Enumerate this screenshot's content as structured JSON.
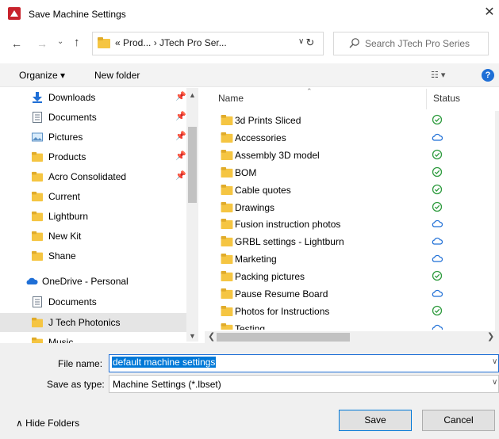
{
  "window": {
    "title": "Save Machine Settings",
    "close": "✕"
  },
  "address": {
    "path": "«  Prod...  ›  JTech Pro Ser...",
    "search_placeholder": "Search JTech Pro Series"
  },
  "toolbar": {
    "organize": "Organize ▾",
    "new_folder": "New folder",
    "view": "☷ ▾",
    "help": "?"
  },
  "nav": {
    "items": [
      {
        "label": "Downloads",
        "icon": "download-icon",
        "pinned": true
      },
      {
        "label": "Documents",
        "icon": "document-icon",
        "pinned": true
      },
      {
        "label": "Pictures",
        "icon": "pictures-icon",
        "pinned": true
      },
      {
        "label": "Products",
        "icon": "folder-icon",
        "pinned": true
      },
      {
        "label": "Acro Consolidated",
        "icon": "folder-icon",
        "pinned": true
      },
      {
        "label": "Current",
        "icon": "folder-icon",
        "pinned": false
      },
      {
        "label": "Lightburn",
        "icon": "folder-icon",
        "pinned": false
      },
      {
        "label": "New Kit",
        "icon": "folder-icon",
        "pinned": false
      },
      {
        "label": "Shane",
        "icon": "folder-icon",
        "pinned": false
      },
      {
        "label": "OneDrive - Personal",
        "icon": "onedrive-icon",
        "pinned": false
      },
      {
        "label": "Documents",
        "icon": "document-icon",
        "pinned": false
      },
      {
        "label": "J Tech Photonics",
        "icon": "folder-icon",
        "pinned": false,
        "selected": true
      },
      {
        "label": "Music",
        "icon": "folder-icon",
        "pinned": false
      }
    ]
  },
  "filelist": {
    "columns": {
      "name": "Name",
      "status": "Status"
    },
    "rows": [
      {
        "name": "3d Prints Sliced",
        "status": "synced"
      },
      {
        "name": "Accessories",
        "status": "cloud"
      },
      {
        "name": "Assembly 3D model",
        "status": "synced"
      },
      {
        "name": "BOM",
        "status": "synced"
      },
      {
        "name": "Cable quotes",
        "status": "synced"
      },
      {
        "name": "Drawings",
        "status": "synced"
      },
      {
        "name": "Fusion instruction photos",
        "status": "cloud"
      },
      {
        "name": "GRBL settings - Lightburn",
        "status": "cloud"
      },
      {
        "name": "Marketing",
        "status": "cloud"
      },
      {
        "name": "Packing pictures",
        "status": "synced"
      },
      {
        "name": "Pause Resume Board",
        "status": "cloud"
      },
      {
        "name": "Photos for Instructions",
        "status": "synced"
      },
      {
        "name": "Testing",
        "status": "cloud"
      }
    ]
  },
  "form": {
    "filename_label": "File name:",
    "filename_value": "default machine settings",
    "savetype_label": "Save as type:",
    "savetype_value": "Machine Settings (*.lbset)"
  },
  "footer": {
    "hide_folders": "∧  Hide Folders",
    "save": "Save",
    "cancel": "Cancel"
  },
  "colors": {
    "accent": "#0078d7",
    "folder": "#f5c542",
    "synced": "#2e9b3e",
    "cloud": "#1f6fd6"
  }
}
